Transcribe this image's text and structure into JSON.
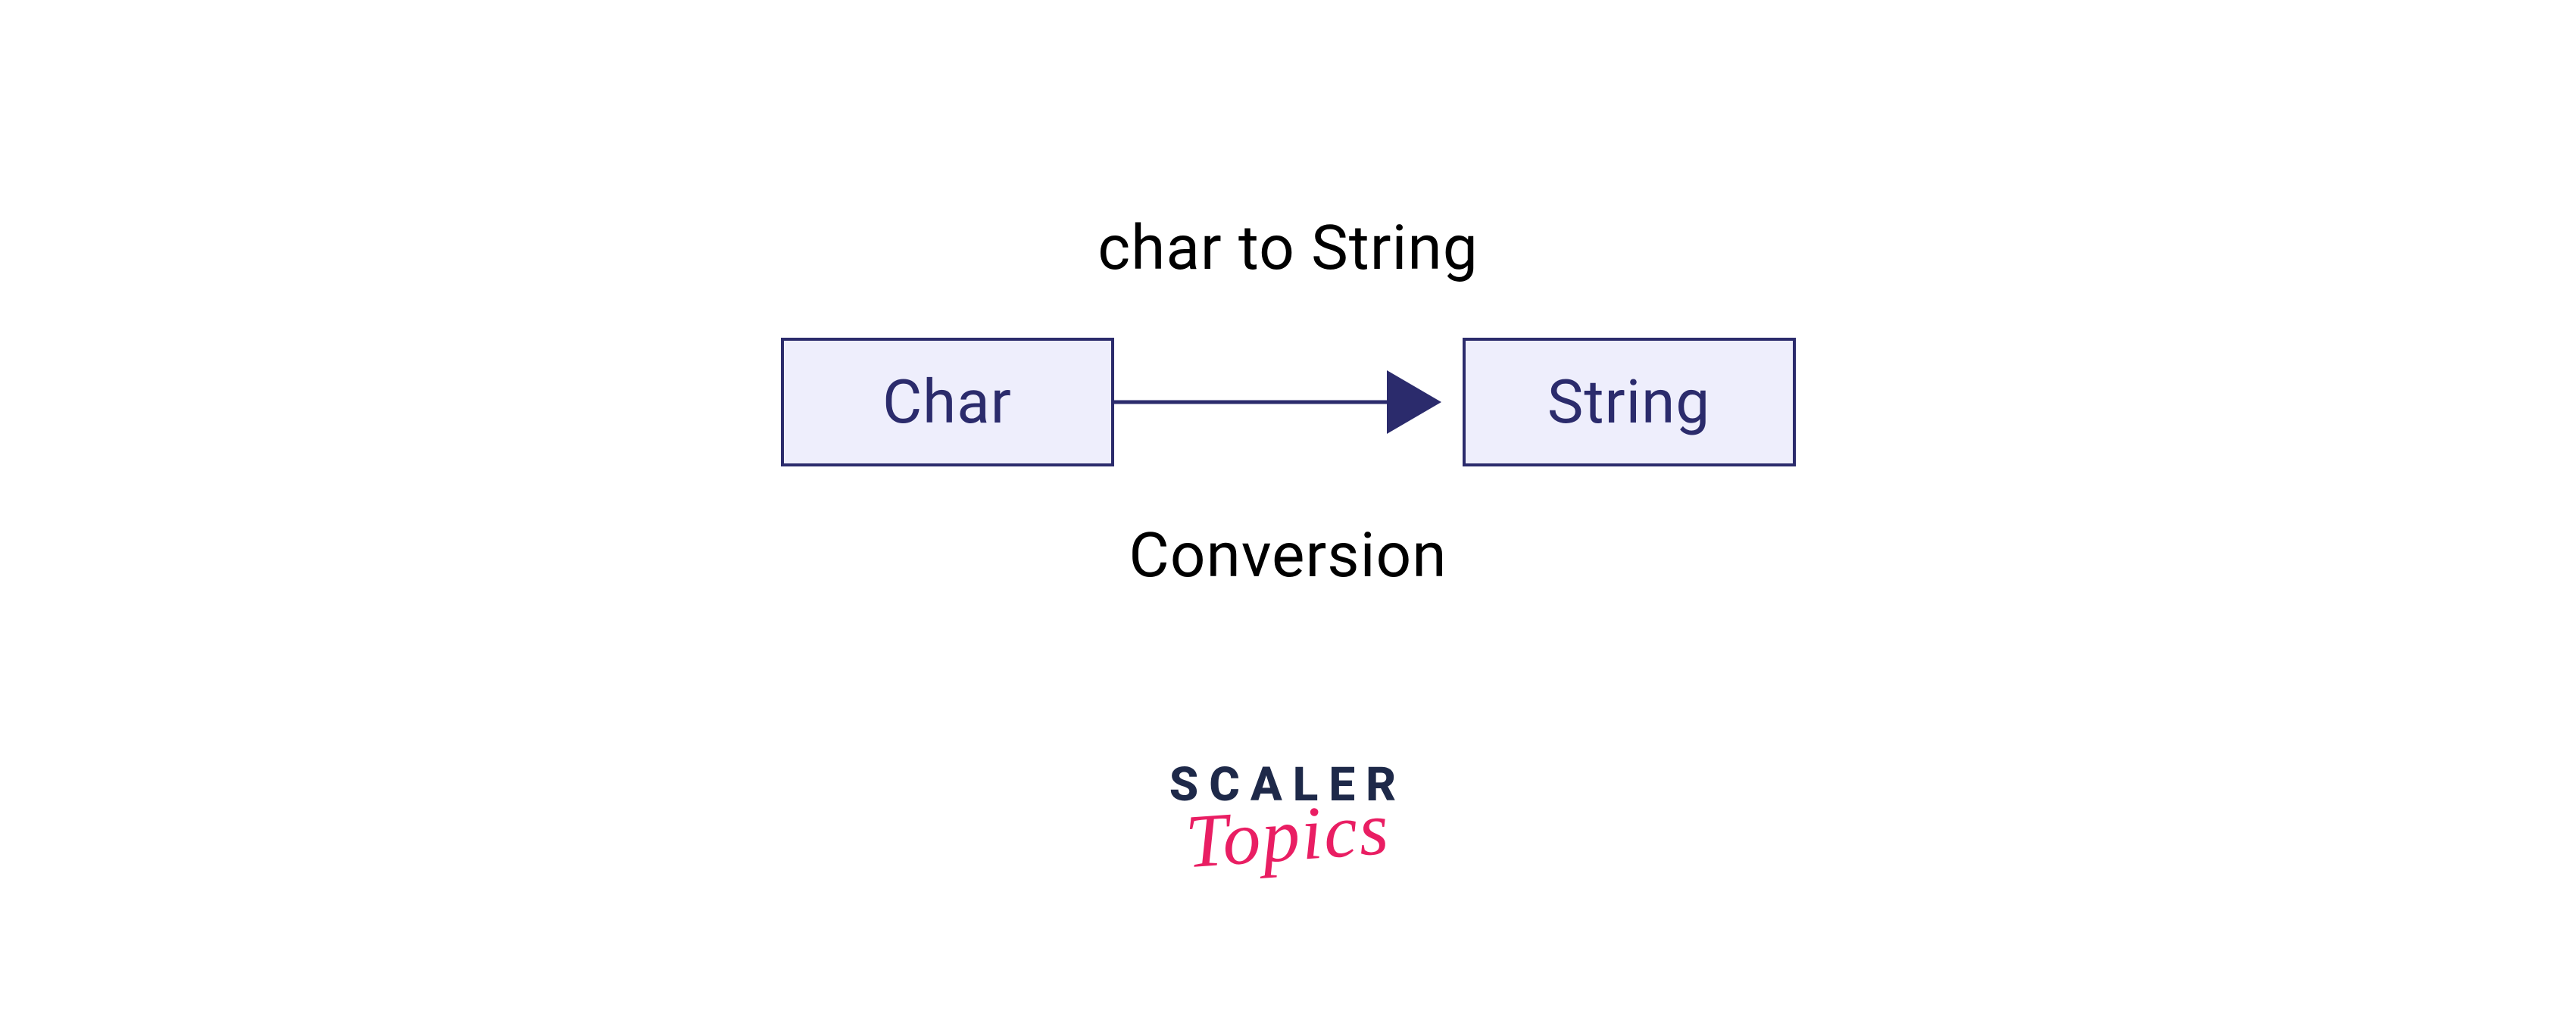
{
  "diagram": {
    "title": "char to String",
    "source_box": "Char",
    "target_box": "String",
    "subtitle": "Conversion"
  },
  "logo": {
    "line1": "SCALER",
    "line2": "Topics"
  },
  "colors": {
    "box_bg": "#eeeefc",
    "box_border": "#2b2b6c",
    "box_text": "#2b2b6c",
    "title_text": "#000000",
    "logo_dark": "#1e2949",
    "logo_accent": "#e91e63"
  }
}
